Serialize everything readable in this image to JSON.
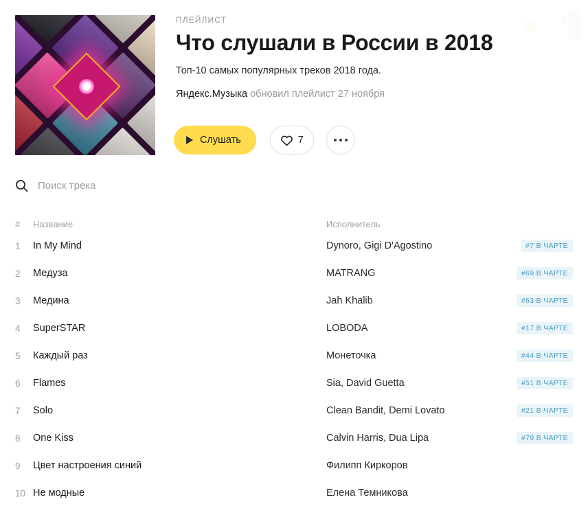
{
  "header": {
    "kicker": "ПЛЕЙЛИСТ",
    "title": "Что слушали в России в 2018",
    "subtitle": "Топ-10 самых популярных треков 2018 года.",
    "owner": "Яндекс.Музыка",
    "meta_rest": " обновил плейлист 27 ноября",
    "cover_alt": "cover-collage"
  },
  "actions": {
    "play_label": "Слушать",
    "like_count": "7",
    "more_label": "···"
  },
  "search": {
    "placeholder": "Поиск трека",
    "value": ""
  },
  "table": {
    "columns": {
      "number": "#",
      "name": "Название",
      "artist": "Исполнитель"
    },
    "rows": [
      {
        "num": "1",
        "name": "In My Mind",
        "artist": "Dynoro, Gigi D'Agostino",
        "badge": "#7 В ЧАРТЕ"
      },
      {
        "num": "2",
        "name": "Медуза",
        "artist": "MATRANG",
        "badge": "#69 В ЧАРТЕ"
      },
      {
        "num": "3",
        "name": "Медина",
        "artist": "Jah Khalib",
        "badge": "#63 В ЧАРТЕ"
      },
      {
        "num": "4",
        "name": "SuperSTAR",
        "artist": "LOBODA",
        "badge": "#17 В ЧАРТЕ"
      },
      {
        "num": "5",
        "name": "Каждый раз",
        "artist": "Монеточка",
        "badge": "#44 В ЧАРТЕ"
      },
      {
        "num": "6",
        "name": "Flames",
        "artist": "Sia, David Guetta",
        "badge": "#51 В ЧАРТЕ"
      },
      {
        "num": "7",
        "name": "Solo",
        "artist": "Clean Bandit, Demi Lovato",
        "badge": "#21 В ЧАРТЕ"
      },
      {
        "num": "8",
        "name": "One Kiss",
        "artist": "Calvin Harris, Dua Lipa",
        "badge": "#79 В ЧАРТЕ"
      },
      {
        "num": "9",
        "name": "Цвет настроения синий",
        "artist": "Филипп Киркоров",
        "badge": ""
      },
      {
        "num": "10",
        "name": "Не модные",
        "artist": "Елена Темникова",
        "badge": ""
      }
    ]
  },
  "colors": {
    "accent_yellow": "#ffdb4d",
    "badge_bg": "#e9f4f8",
    "badge_text": "#4b9cc0",
    "muted_text": "#a0a0a0",
    "primary_text": "#1a1a1a"
  },
  "cover_tiles": [
    "#c33a6a",
    "#e8e0d8",
    "#f3e2c8",
    "#bdbdbd",
    "#2b2b33",
    "#5b2a8c",
    "#5e3a78",
    "#e6e2dd",
    "#7a2aa0",
    "#ea3b8c",
    "#3c8fa8",
    "#d8d2cc",
    "#7c2f78",
    "#b01f2e",
    "#2f3034",
    "#f2c12e"
  ]
}
